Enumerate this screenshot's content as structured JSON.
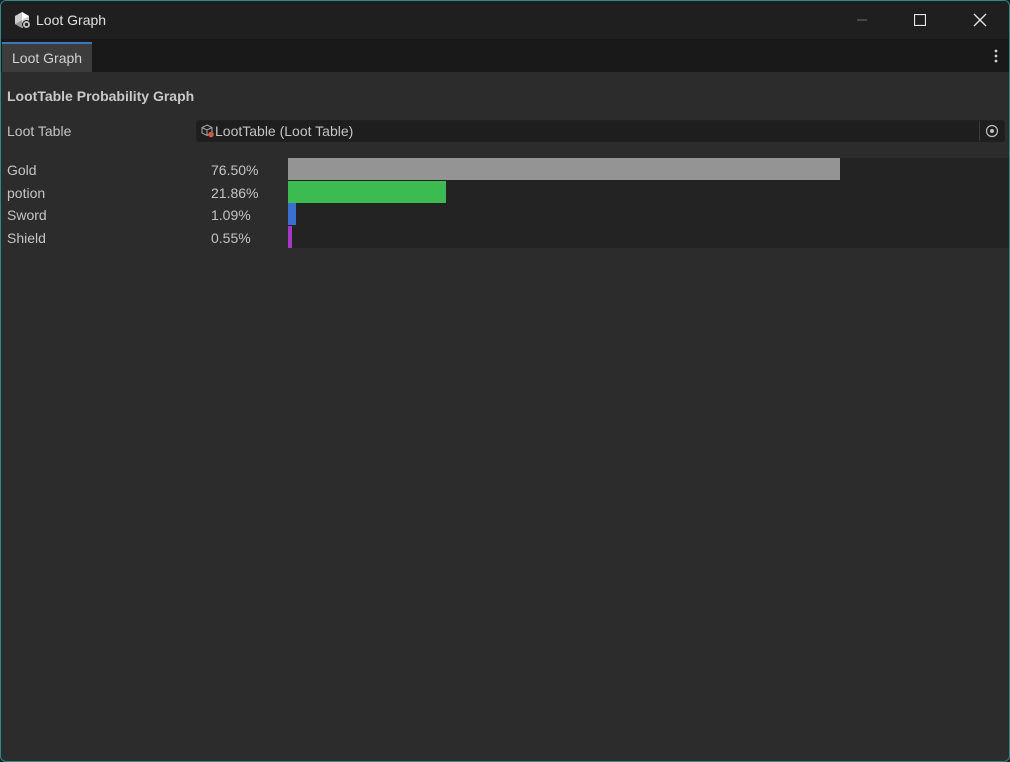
{
  "window": {
    "title": "Loot Graph",
    "controls": {
      "minimize": "minimize-icon",
      "maximize": "maximize-icon",
      "close": "close-icon"
    }
  },
  "tabs": [
    {
      "label": "Loot Graph",
      "active": true
    }
  ],
  "header": {
    "title": "LootTable Probability Graph"
  },
  "field": {
    "label": "Loot Table",
    "value": "LootTable (Loot Table)"
  },
  "colors": {
    "accent": "#3a79bb",
    "window_border": "#2a8a8f"
  },
  "chart_data": {
    "type": "bar",
    "orientation": "horizontal",
    "categories": [
      "Gold",
      "potion",
      "Sword",
      "Shield"
    ],
    "values": [
      76.5,
      21.86,
      1.09,
      0.55
    ],
    "labels": [
      "76.50%",
      "21.86%",
      "1.09%",
      "0.55%"
    ],
    "colors": [
      "#949494",
      "#3cbc50",
      "#3a6fd0",
      "#a838c8"
    ],
    "xlim": [
      0,
      100
    ]
  }
}
